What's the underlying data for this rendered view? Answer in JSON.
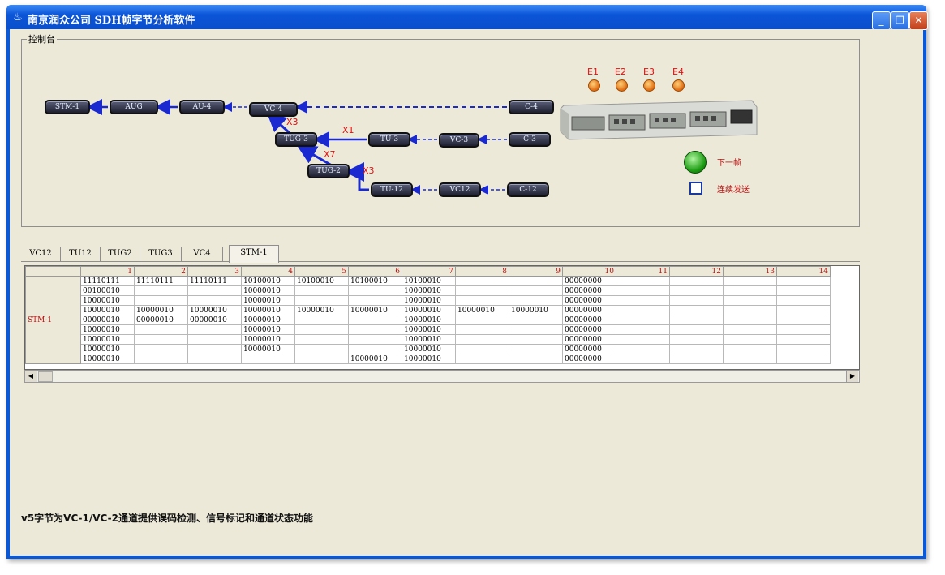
{
  "window": {
    "title": "南京润众公司  SDH帧字节分析软件",
    "icon": "app-icon",
    "buttons": {
      "minimize": "_",
      "restore": "❐",
      "close": "✕"
    }
  },
  "console": {
    "legend": "控制台",
    "nodes": {
      "stm1": "STM-1",
      "aug": "AUG",
      "au4": "AU-4",
      "vc4": "VC-4",
      "c4": "C-4",
      "tug3": "TUG-3",
      "tu3": "TU-3",
      "vc3": "VC-3",
      "c3": "C-3",
      "tug2": "TUG-2",
      "tu12": "TU-12",
      "vc12": "VC12",
      "c12": "C-12"
    },
    "multipliers": {
      "x3_top": "X3",
      "x1": "X1",
      "x7": "X7",
      "x3_bottom": "X3"
    },
    "leds": [
      "E1",
      "E2",
      "E3",
      "E4"
    ],
    "next_frame_label": "下一帧",
    "continuous_send_label": "连续发送"
  },
  "tabs": [
    {
      "label": "VC12",
      "selected": false
    },
    {
      "label": "TU12",
      "selected": false
    },
    {
      "label": "TUG2",
      "selected": false
    },
    {
      "label": "TUG3",
      "selected": false
    },
    {
      "label": "VC4",
      "selected": false
    },
    {
      "label": "STM-1",
      "selected": true
    }
  ],
  "grid": {
    "row_label": "STM-1",
    "columns": [
      "1",
      "2",
      "3",
      "4",
      "5",
      "6",
      "7",
      "8",
      "9",
      "10",
      "11",
      "12",
      "13",
      "14"
    ],
    "rows": [
      [
        "11110111",
        "11110111",
        "11110111",
        "10100010",
        "10100010",
        "10100010",
        "10100010",
        "",
        "",
        "00000000",
        "",
        "",
        "",
        ""
      ],
      [
        "00100010",
        "",
        "",
        "10000010",
        "",
        "",
        "10000010",
        "",
        "",
        "00000000",
        "",
        "",
        "",
        ""
      ],
      [
        "10000010",
        "",
        "",
        "10000010",
        "",
        "",
        "10000010",
        "",
        "",
        "00000000",
        "",
        "",
        "",
        ""
      ],
      [
        "10000010",
        "10000010",
        "10000010",
        "10000010",
        "10000010",
        "10000010",
        "10000010",
        "10000010",
        "10000010",
        "00000000",
        "",
        "",
        "",
        ""
      ],
      [
        "00000010",
        "00000010",
        "00000010",
        "10000010",
        "",
        "",
        "10000010",
        "",
        "",
        "00000000",
        "",
        "",
        "",
        ""
      ],
      [
        "10000010",
        "",
        "",
        "10000010",
        "",
        "",
        "10000010",
        "",
        "",
        "00000000",
        "",
        "",
        "",
        ""
      ],
      [
        "10000010",
        "",
        "",
        "10000010",
        "",
        "",
        "10000010",
        "",
        "",
        "00000000",
        "",
        "",
        "",
        ""
      ],
      [
        "10000010",
        "",
        "",
        "10000010",
        "",
        "",
        "10000010",
        "",
        "",
        "00000000",
        "",
        "",
        "",
        ""
      ],
      [
        "10000010",
        "",
        "",
        "",
        "",
        "10000010",
        "10000010",
        "",
        "",
        "00000000",
        "",
        "",
        "",
        ""
      ]
    ]
  },
  "status_text": "v5字节为VC-1/VC-2通道提供误码检测、信号标记和通道状态功能"
}
